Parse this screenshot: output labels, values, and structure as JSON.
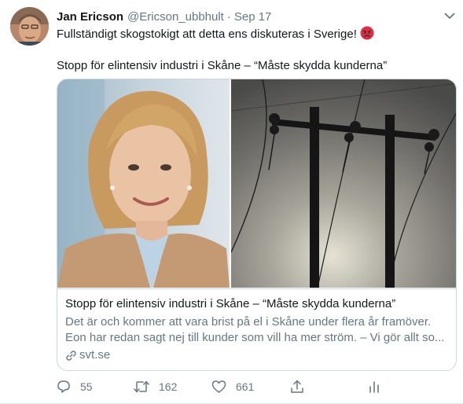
{
  "tweet": {
    "author_name": "Jan Ericson",
    "author_handle": "@Ericson_ubbhult",
    "separator": "·",
    "date": "Sep 17",
    "text_line1": "Fullständigt skogstokigt att detta ens diskuteras i Sverige!",
    "text_line2": "Stopp för elintensiv industri i Skåne – “Måste skydda kunderna”",
    "emoji_icon": "angry-face-icon",
    "card": {
      "title": "Stopp för elintensiv industri i Skåne – “Måste skydda kunderna”",
      "description_line1": "Det är och kommer att vara brist på el i Skåne under flera år framöver.",
      "description_line2": "Eon har redan sagt nej till kunder som vill ha mer ström. – Vi gör allt so...",
      "domain": "svt.se"
    },
    "actions": {
      "replies": "55",
      "retweets": "162",
      "likes": "661"
    }
  },
  "colors": {
    "text": "#14171a",
    "secondary": "#657786",
    "border": "#ccd6dd"
  }
}
